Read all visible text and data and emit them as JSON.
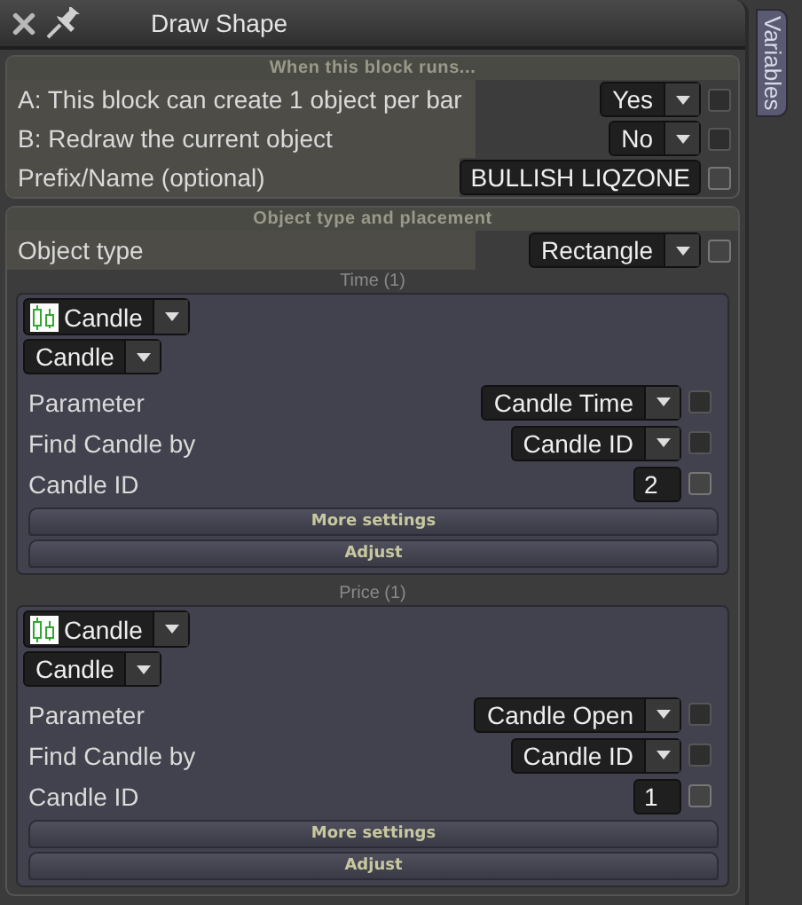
{
  "window": {
    "title": "Draw Shape"
  },
  "side_tab": {
    "label": "Variables"
  },
  "sections": [
    {
      "title": "When this block runs...",
      "rows": [
        {
          "label": "A: This block can create 1 object per bar",
          "kind": "dropdown",
          "value": "Yes",
          "checkbox_disabled": true
        },
        {
          "label": "B: Redraw the current object",
          "kind": "dropdown",
          "value": "No",
          "checkbox_disabled": true
        },
        {
          "label": "Prefix/Name (optional)",
          "kind": "input",
          "value": "BULLISH LIQZONE",
          "checkbox_disabled": false
        }
      ]
    },
    {
      "title": "Object type and placement",
      "rows": [
        {
          "label": "Object type",
          "kind": "dropdown",
          "value": "Rectangle",
          "checkbox_disabled": false
        }
      ],
      "groups": [
        {
          "title": "Time (1)",
          "source": "Candle",
          "type": "Candle",
          "rows": [
            {
              "label": "Parameter",
              "kind": "dropdown",
              "value": "Candle Time",
              "checkbox_disabled": true
            },
            {
              "label": "Find Candle by",
              "kind": "dropdown",
              "value": "Candle ID",
              "checkbox_disabled": true
            },
            {
              "label": "Candle ID",
              "kind": "input",
              "value": "2",
              "checkbox_disabled": false
            }
          ],
          "buttons": [
            "More settings",
            "Adjust"
          ]
        },
        {
          "title": "Price (1)",
          "source": "Candle",
          "type": "Candle",
          "rows": [
            {
              "label": "Parameter",
              "kind": "dropdown",
              "value": "Candle Open",
              "checkbox_disabled": true
            },
            {
              "label": "Find Candle by",
              "kind": "dropdown",
              "value": "Candle ID",
              "checkbox_disabled": true
            },
            {
              "label": "Candle ID",
              "kind": "input",
              "value": "1",
              "checkbox_disabled": false
            }
          ],
          "buttons": [
            "More settings",
            "Adjust"
          ]
        }
      ]
    }
  ]
}
